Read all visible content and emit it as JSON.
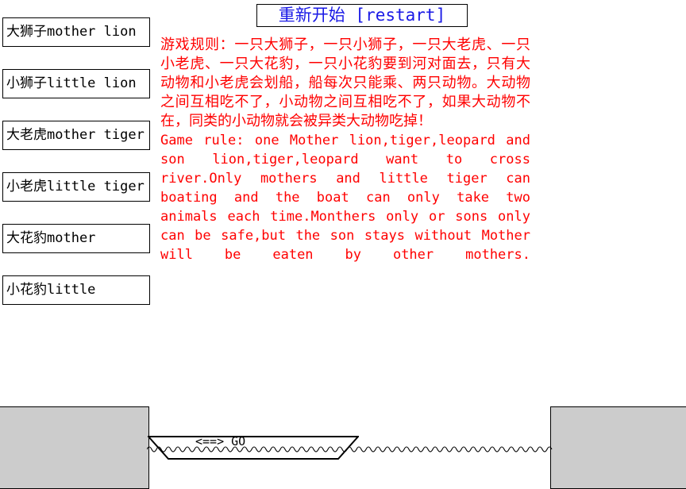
{
  "restart": {
    "label": "重新开始 [restart]",
    "color": "#1a1ae6"
  },
  "animals": [
    {
      "label": "大狮子mother lion",
      "name": "animal-mother-lion"
    },
    {
      "label": "小狮子little lion",
      "name": "animal-little-lion"
    },
    {
      "label": "大老虎mother tiger",
      "name": "animal-mother-tiger"
    },
    {
      "label": "小老虎little tiger",
      "name": "animal-little-tiger"
    },
    {
      "label": "大花豹mother",
      "name": "animal-mother-leopard"
    },
    {
      "label": "小花豹little",
      "name": "animal-little-leopard"
    }
  ],
  "rules": {
    "color": "#ff0000",
    "chinese": "游戏规则：一只大狮子，一只小狮子，一只大老虎、一只小老虎、一只大花豹，一只小花豹要到河对面去，只有大动物和小老虎会划船，船每次只能乘、两只动物。大动物之间互相吃不了，小动物之间互相吃不了，如果大动物不在，同类的小动物就会被异类大动物吃掉！",
    "english": "Game rule: one Mother lion,tiger,leopard and son lion,tiger,leopard want to cross river.Only mothers and little tiger can boating and the boat can only take two animals each time.Monthers only or sons only can be safe,but the son stays without Mother will be eaten by other mothers."
  },
  "scene": {
    "boat_label": "<==> GO",
    "bank_color": "#cccccc",
    "water_color": "#ffffff",
    "outline_color": "#000000"
  }
}
